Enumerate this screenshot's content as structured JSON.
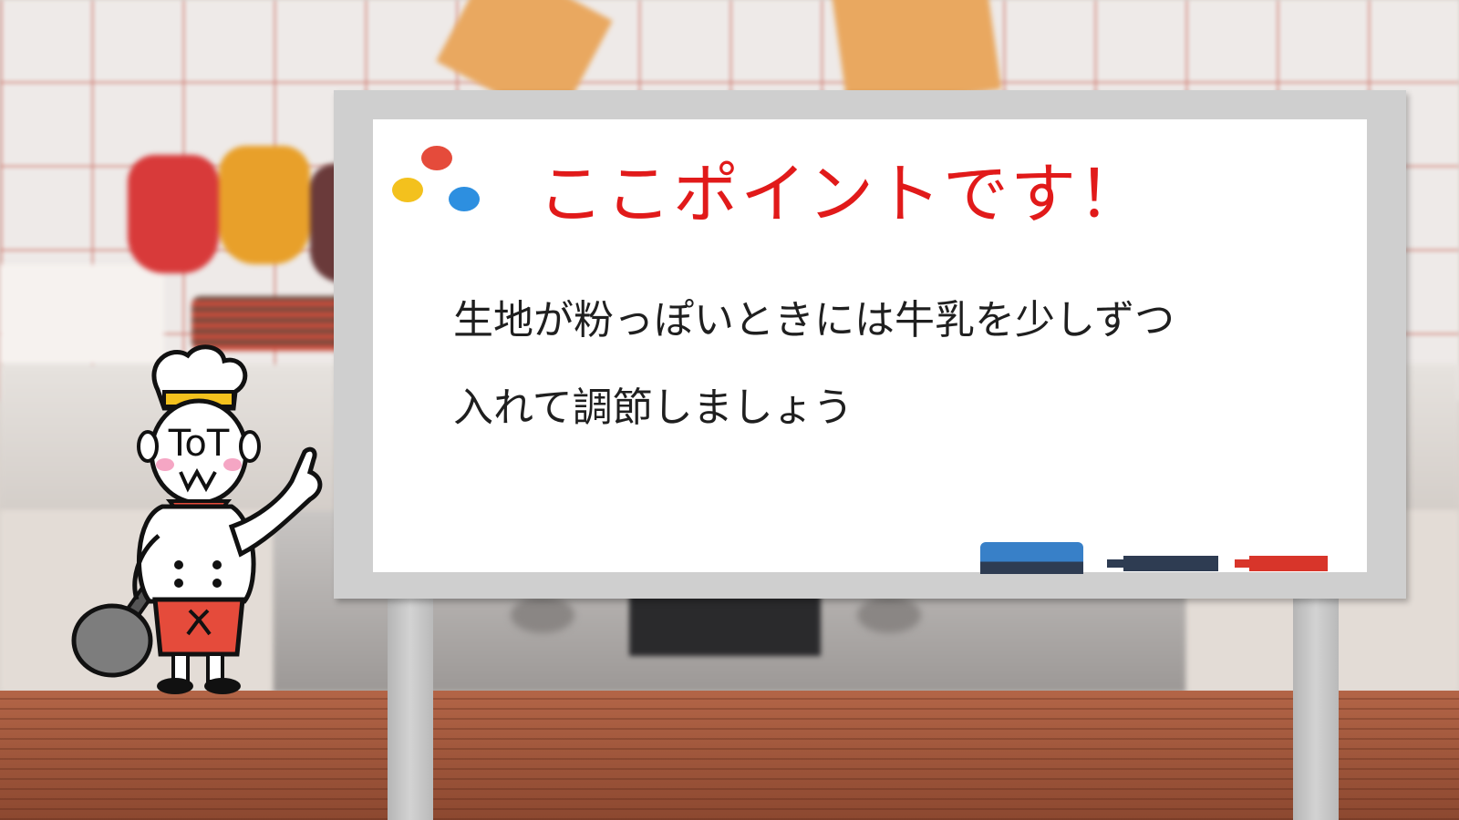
{
  "board": {
    "title": "ここポイントです！",
    "lines": [
      "生地が粉っぽいときには牛乳を少しずつ",
      "入れて調節しましょう"
    ]
  },
  "mascot": {
    "face_text": "ToT"
  },
  "colors": {
    "title_red": "#e11a1a",
    "dot_red": "#e54b3b",
    "dot_yellow": "#f3c11d",
    "dot_blue": "#2d8fe0",
    "eraser_blue": "#3880c8",
    "marker_navy": "#2e3c52",
    "marker_red": "#d8352a"
  },
  "icons": [
    "three-dots-logo-icon",
    "eraser-icon",
    "marker-icon",
    "chef-mascot-icon",
    "frying-pan-icon"
  ]
}
